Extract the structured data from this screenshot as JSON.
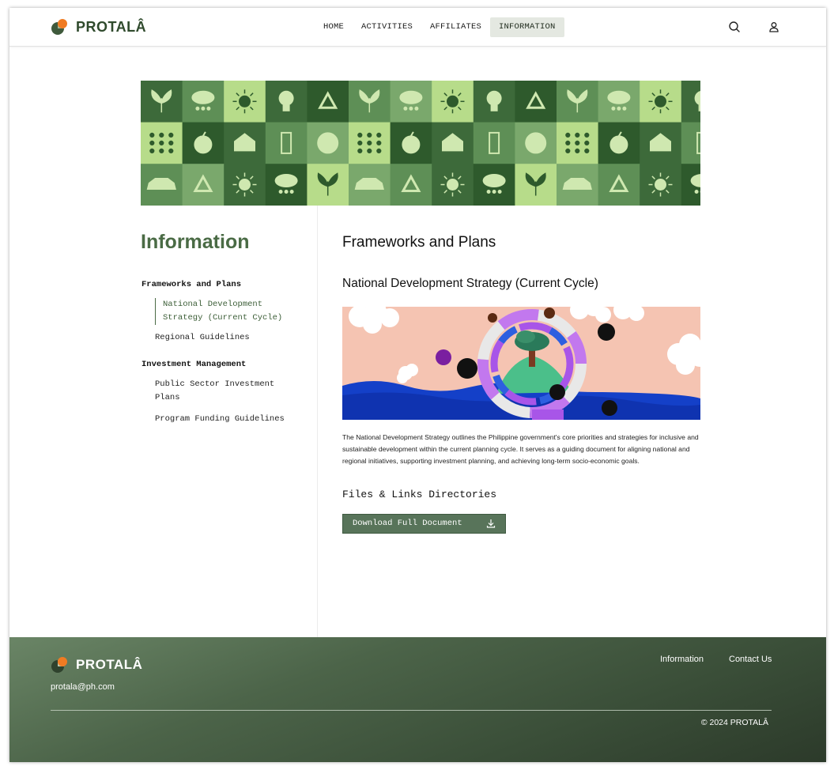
{
  "brand": {
    "name": "PROTALÂ",
    "accent": "#f07b22",
    "primary": "#4a6b45"
  },
  "nav": {
    "items": [
      {
        "label": "HOME",
        "active": false
      },
      {
        "label": "ACTIVITIES",
        "active": false
      },
      {
        "label": "AFFILIATES",
        "active": false
      },
      {
        "label": "INFORMATION",
        "active": true
      }
    ],
    "search_icon": "search-icon",
    "account_icon": "user-icon"
  },
  "sidebar": {
    "title": "Information",
    "groups": [
      {
        "label": "Frameworks and Plans",
        "items": [
          {
            "label": "National Development Strategy (Current Cycle)",
            "active": true
          },
          {
            "label": "Regional Guidelines",
            "active": false
          }
        ]
      },
      {
        "label": "Investment Management",
        "items": [
          {
            "label": "Public Sector Investment Plans",
            "active": false
          },
          {
            "label": "Program Funding Guidelines",
            "active": false
          }
        ]
      }
    ]
  },
  "main": {
    "section_title": "Frameworks and Plans",
    "document_title": "National Development Strategy (Current Cycle)",
    "description": "The National Development Strategy outlines the Philippine government's core priorities and strategies for inclusive and sustainable development within the current planning cycle. It serves as a guiding document for aligning national and regional initiatives, supporting investment planning, and achieving long-term socio-economic goals.",
    "files_title": "Files & Links Directories",
    "download_label": "Download Full Document",
    "download_icon": "download-icon"
  },
  "footer": {
    "brand": "PROTALÂ",
    "email": "protala@ph.com",
    "links": [
      "Information",
      "Contact Us"
    ],
    "copyright": "©  2024 PROTALÂ"
  }
}
